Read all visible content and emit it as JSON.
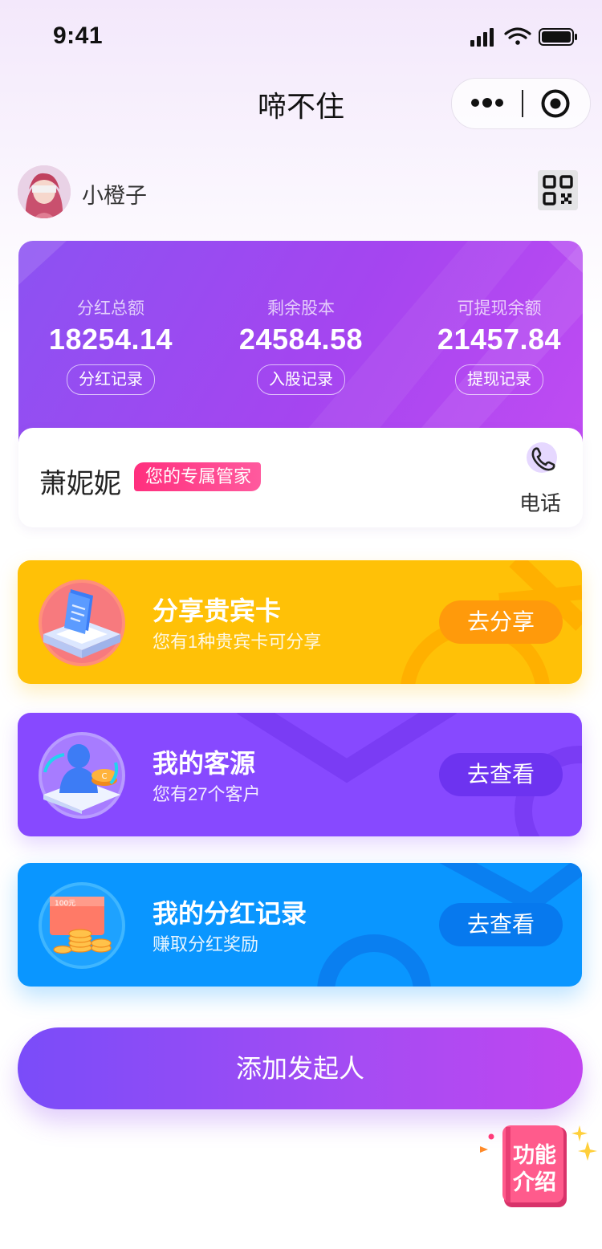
{
  "status_bar": {
    "time": "9:41"
  },
  "nav": {
    "title": "啼不住"
  },
  "user": {
    "name": "小橙子"
  },
  "stats": [
    {
      "label": "分红总额",
      "value": "18254.14",
      "button": "分红记录"
    },
    {
      "label": "剩余股本",
      "value": "24584.58",
      "button": "入股记录"
    },
    {
      "label": "可提现余额",
      "value": "21457.84",
      "button": "提现记录"
    }
  ],
  "manager": {
    "name": "萧妮妮",
    "badge": "您的专属管家",
    "phone_label": "电话"
  },
  "cards": [
    {
      "title": "分享贵宾卡",
      "subtitle": "您有1种贵宾卡可分享",
      "button": "去分享",
      "icon": "vip-card-icon",
      "color": "#ffc107"
    },
    {
      "title": "我的客源",
      "subtitle": "您有27个客户",
      "button": "去查看",
      "icon": "customer-icon",
      "color": "#8749ff"
    },
    {
      "title": "我的分红记录",
      "subtitle": "赚取分红奖励",
      "button": "去查看",
      "icon": "dividend-coins-icon",
      "color": "#0a96ff",
      "coupon_text": "100元"
    }
  ],
  "add_button": "添加发起人",
  "intro": {
    "line1": "功能",
    "line2": "介绍"
  }
}
